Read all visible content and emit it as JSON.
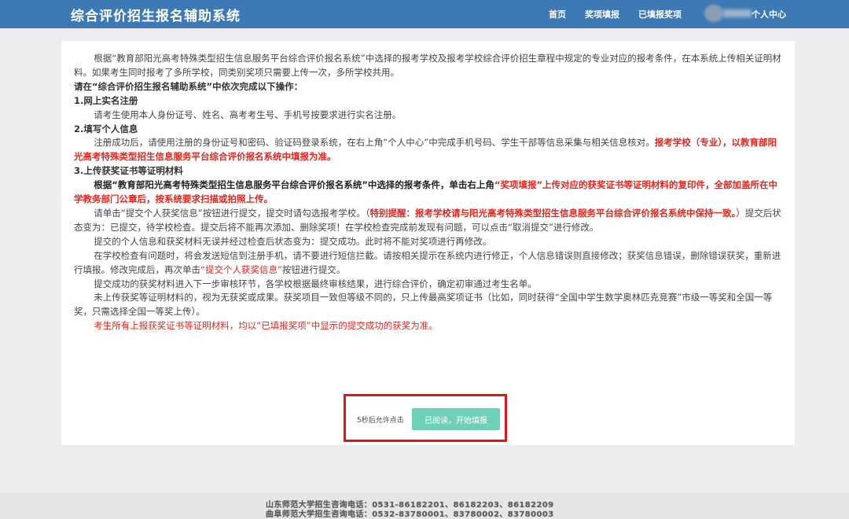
{
  "header": {
    "app_title": "综合评价招生报名辅助系统",
    "nav": {
      "home": "首页",
      "award_fill": "奖项填报",
      "submitted_awards": "已填报奖项",
      "personal_center": "个人中心"
    }
  },
  "instructions": {
    "intro": "根据“教育部阳光高考特殊类型招生信息服务平台综合评价报名系统”中选择的报考学校及报考学校综合评价招生章程中规定的专业对应的报考条件，在本系统上传相关证明材料。如果考生同时报考了多所学校，同类别奖项只需要上传一次，多所学校共用。",
    "steps_title": "请在“综合评价招生报名辅助系统”中依次完成以下操作：",
    "step1_title": "1.网上实名注册",
    "step1_text": "请考生使用本人身份证号、姓名、高考考生号、手机号按要求进行实名注册。",
    "step2_title": "2.填写个人信息",
    "step2_text": "注册成功后，请使用注册的身份证号和密码、验证码登录系统，在右上角“个人中心”中完成手机号码、学生干部等信息采集与相关信息核对。",
    "step2_red": "报考学校（专业），以教育部阳光高考特殊类型招生信息服务平台综合评价报名系统中填报为准。",
    "step3_title": "3.上传获奖证书等证明材料",
    "step3_text_a": "根据“教育部阳光高考特殊类型招生信息服务平台综合评价报名系统”中选择的报考条件，单击右上角",
    "step3_red_a": "“奖项填报”上传对应的获奖证书等证明材料的复印件，全部加盖所在中学教务部门公章后，按系统要求扫描或拍照上传。",
    "submit_text_a": "请单击“提交个人获奖信息”按钮进行提交，提交时请勾选报考学校。（",
    "submit_red": "特别提醒：报考学校请与阳光高考特殊类型招生信息服务平台综合评价报名系统中保持一致。",
    "submit_text_b": "）提交后状态变为：已提交，待学校检查。提交后将不能再次添加、删除奖项！在学校检查完成前发现有问题，可以点击“取消提交”进行修改。",
    "para_success": "提交的个人信息和获奖材料无误并经过检查后状态变为：提交成功。此时将不能对奖项进行再修改。",
    "para_problem_a": "在学校检查有问题时，将会发送短信到注册手机，请不要进行短信拦截。请按相关提示在系统内进行修正，个人信息错误则直接修改；获奖信息错误，删除错误获奖，重新进行填报。修改完成后，再次单击",
    "para_problem_red": "“提交个人获奖信息”",
    "para_problem_b": "按钮进行提交。",
    "para_review": "提交成功的获奖材料进入下一步审核环节，各学校根据最终审核结果，进行综合评价，确定初审通过考生名单。",
    "para_noupload": "未上传获奖等证明材料的，视为无获奖或成果。获奖项目一致但等级不同的，只上传最高奖项证书（比如，同时获得“全国中学生数学奥林匹克竞赛”市级一等奖和全国一等奖，只需选择全国一等奖上传）。",
    "para_final_red": "考生所有上报获奖证书等证明材料，均以“已填报奖项”中显示的提交成功的获奖为准。"
  },
  "action": {
    "countdown": "5秒后允许点击",
    "start_button": "已阅读，开始填报"
  },
  "footer": {
    "line1": "山东师范大学招生咨询电话：0531-86182201、86182203、86182209",
    "line2": "曲阜师范大学招生咨询电话：0532-83780001、83780002、83780003"
  }
}
